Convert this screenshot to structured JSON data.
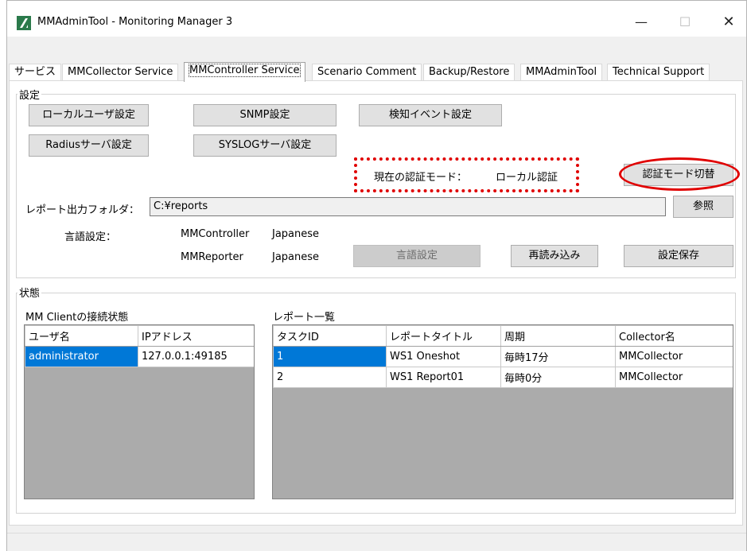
{
  "window": {
    "title": "MMAdminTool - Monitoring Manager 3",
    "minimize": "—",
    "maximize": "☐",
    "close": "✕"
  },
  "tabs": [
    {
      "label": "サービス"
    },
    {
      "label": "MMCollector Service"
    },
    {
      "label": "MMController Service"
    },
    {
      "label": "Scenario Comment"
    },
    {
      "label": "Backup/Restore"
    },
    {
      "label": "MMAdminTool"
    },
    {
      "label": "Technical Support"
    }
  ],
  "settings": {
    "group_title": "設定",
    "local_user_btn": "ローカルユーザ設定",
    "snmp_btn": "SNMP設定",
    "detect_event_btn": "検知イベント設定",
    "radius_btn": "Radiusサーバ設定",
    "syslog_btn": "SYSLOGサーバ設定",
    "auth_mode_label": "現在の認証モード：",
    "auth_mode_value": "ローカル認証",
    "auth_switch_btn": "認証モード切替",
    "report_folder_label": "レポート出力フォルダ：",
    "report_folder_value": "C:¥reports",
    "browse_btn": "参照",
    "lang_label": "言語設定：",
    "lang_rows": [
      {
        "component": "MMController",
        "language": "Japanese"
      },
      {
        "component": "MMReporter",
        "language": "Japanese"
      }
    ],
    "lang_btn": "言語設定",
    "reload_btn": "再読み込み",
    "save_btn": "設定保存"
  },
  "status": {
    "group_title": "状態",
    "clients_title": "MM Clientの接続状態",
    "clients_columns": [
      "ユーザ名",
      "IPアドレス"
    ],
    "clients_rows": [
      {
        "user": "administrator",
        "ip": "127.0.0.1:49185"
      }
    ],
    "reports_title": "レポート一覧",
    "reports_columns": [
      "タスクID",
      "レポートタイトル",
      "周期",
      "Collector名"
    ],
    "reports_rows": [
      {
        "id": "1",
        "title": "WS1 Oneshot",
        "period": "毎時17分",
        "collector": "MMCollector"
      },
      {
        "id": "2",
        "title": "WS1 Report01",
        "period": "毎時0分",
        "collector": "MMCollector"
      }
    ]
  },
  "colors": {
    "annotation": "#e00000",
    "selection": "#0078d7"
  }
}
